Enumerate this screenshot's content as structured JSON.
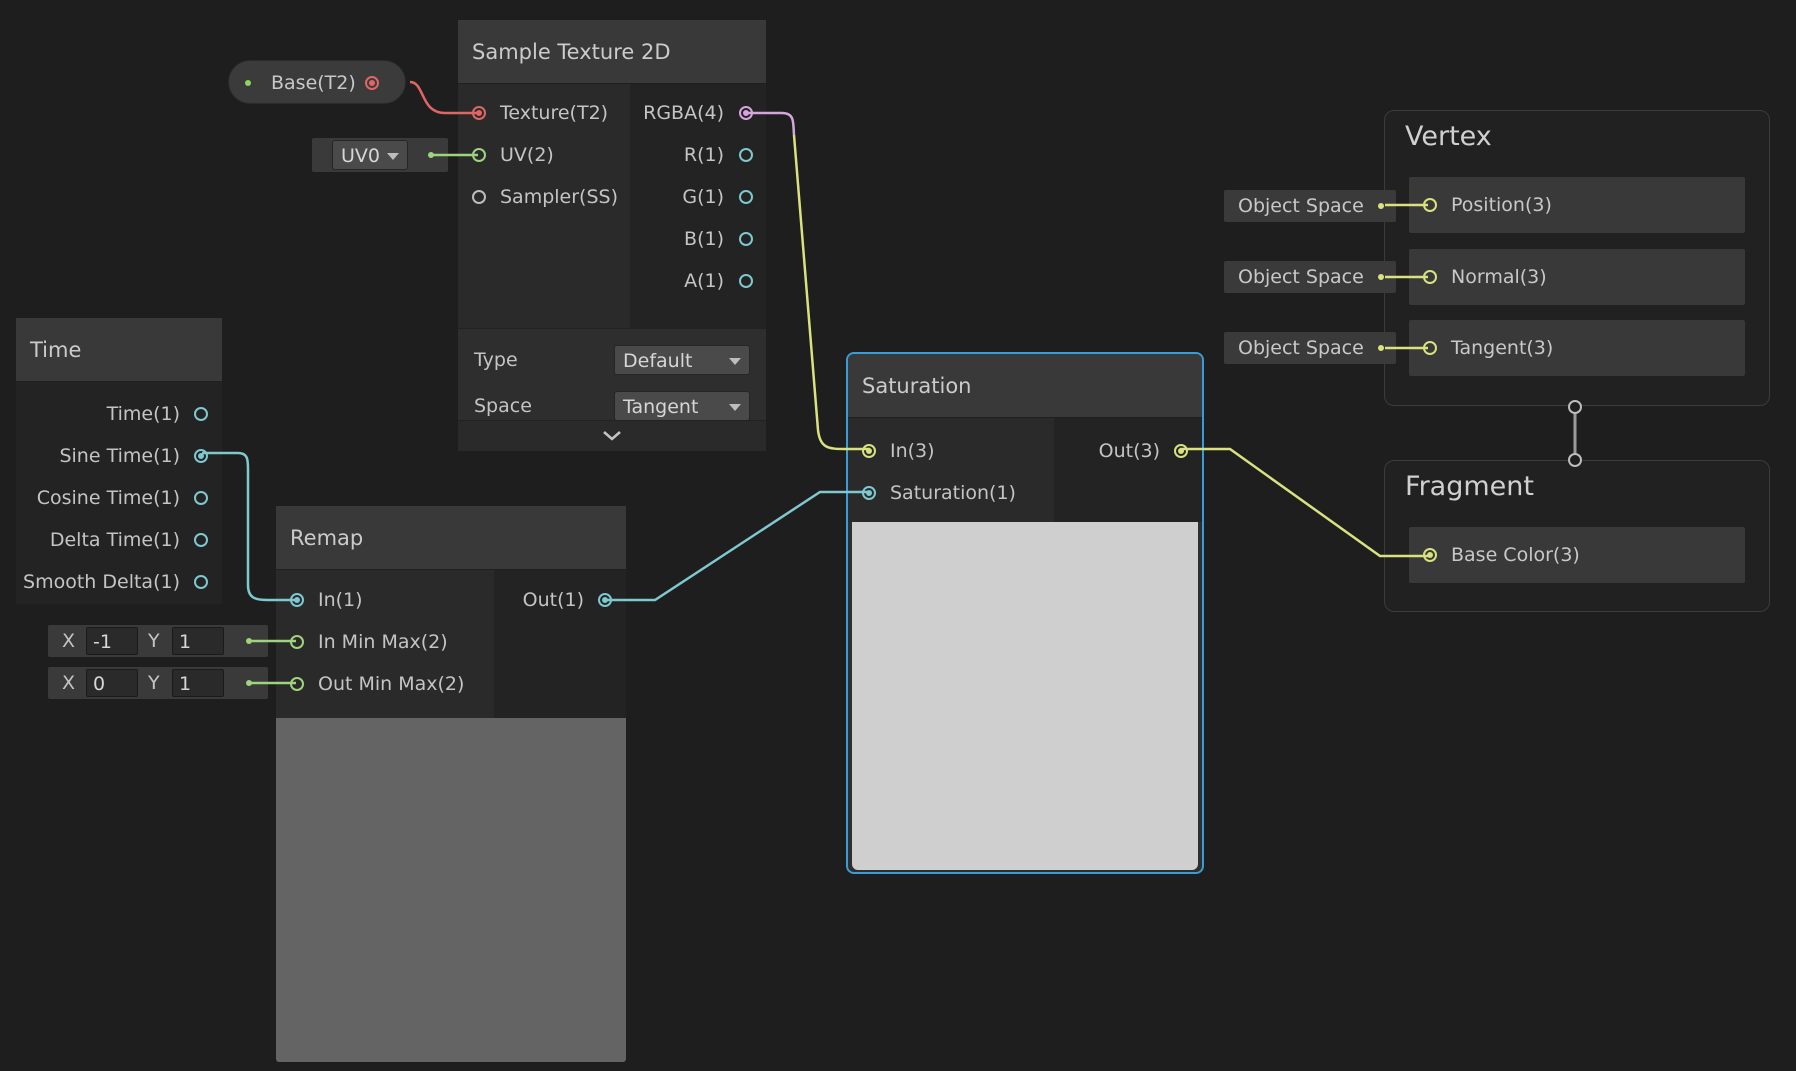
{
  "property_node": {
    "label": "Base(T2)"
  },
  "uv_input": {
    "value": "UV0"
  },
  "sample_texture": {
    "title": "Sample Texture 2D",
    "inputs": [
      "Texture(T2)",
      "UV(2)",
      "Sampler(SS)"
    ],
    "outputs": [
      "RGBA(4)",
      "R(1)",
      "G(1)",
      "B(1)",
      "A(1)"
    ],
    "type_label": "Type",
    "type_value": "Default",
    "space_label": "Space",
    "space_value": "Tangent"
  },
  "time": {
    "title": "Time",
    "outputs": [
      "Time(1)",
      "Sine Time(1)",
      "Cosine Time(1)",
      "Delta Time(1)",
      "Smooth Delta(1)"
    ]
  },
  "remap": {
    "title": "Remap",
    "inputs": [
      "In(1)",
      "In Min Max(2)",
      "Out Min Max(2)"
    ],
    "output": "Out(1)",
    "in_min_max": {
      "x_label": "X",
      "x": "-1",
      "y_label": "Y",
      "y": "1"
    },
    "out_min_max": {
      "x_label": "X",
      "x": "0",
      "y_label": "Y",
      "y": "1"
    }
  },
  "saturation": {
    "title": "Saturation",
    "inputs": [
      "In(3)",
      "Saturation(1)"
    ],
    "output": "Out(3)"
  },
  "vertex": {
    "title": "Vertex",
    "blocks": [
      "Position(3)",
      "Normal(3)",
      "Tangent(3)"
    ],
    "space_inputs": [
      "Object Space",
      "Object Space",
      "Object Space"
    ]
  },
  "fragment": {
    "title": "Fragment",
    "blocks": [
      "Base Color(3)"
    ]
  },
  "colors": {
    "background": "#1e1e1e",
    "texture_wire": "#e06666",
    "uv_wire": "#9fd47f",
    "float_wire": "#7ec8cf",
    "vector3_wire": "#d9e27f",
    "rgba_wire": "#d7a5dd",
    "selection": "#3a9bd6"
  }
}
